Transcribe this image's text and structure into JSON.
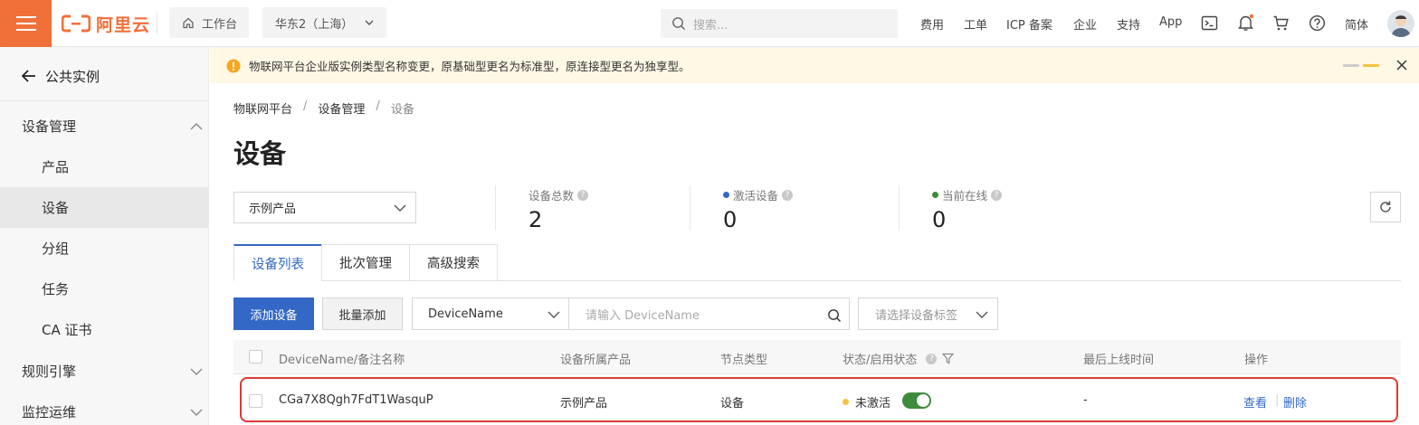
{
  "topbar": {
    "brand": "阿里云",
    "workbench": "工作台",
    "region": "华东2（上海）",
    "search_placeholder": "搜索...",
    "links": [
      "费用",
      "工单",
      "ICP 备案",
      "企业",
      "支持",
      "App"
    ],
    "lang": "简体"
  },
  "sidebar": {
    "back_label": "公共实例",
    "groups": [
      {
        "label": "设备管理",
        "expanded": true,
        "items": [
          "产品",
          "设备",
          "分组",
          "任务",
          "CA 证书"
        ]
      },
      {
        "label": "规则引擎",
        "expanded": false
      },
      {
        "label": "监控运维",
        "expanded": false
      }
    ],
    "active_item": "设备"
  },
  "banner": {
    "text": "物联网平台企业版实例类型名称变更，原基础型更名为标准型，原连接型更名为独享型。"
  },
  "breadcrumb": [
    "物联网平台",
    "设备管理",
    "设备"
  ],
  "page_title": "设备",
  "product_select": "示例产品",
  "stats": {
    "total": {
      "label": "设备总数",
      "value": "2"
    },
    "activated": {
      "label": "激活设备",
      "value": "0",
      "dot_color": "#3368c6"
    },
    "online": {
      "label": "当前在线",
      "value": "0",
      "dot_color": "#3f8a3d"
    }
  },
  "tabs": [
    "设备列表",
    "批次管理",
    "高级搜索"
  ],
  "toolbar": {
    "add": "添加设备",
    "batch_add": "批量添加",
    "field": "DeviceName",
    "search_placeholder": "请输入 DeviceName",
    "tag_placeholder": "请选择设备标签"
  },
  "table": {
    "headers": [
      "DeviceName/备注名称",
      "设备所属产品",
      "节点类型",
      "状态/启用状态",
      "最后上线时间",
      "操作"
    ],
    "rows": [
      {
        "name": "CGa7X8Qgh7FdT1WasquP",
        "product": "示例产品",
        "node_type": "设备",
        "status": "未激活",
        "status_dot": "#f5c242",
        "enabled": true,
        "last_online": "-",
        "actions": [
          "查看",
          "删除"
        ]
      }
    ]
  },
  "colors": {
    "brand": "#f1703a",
    "primary": "#3368c6",
    "highlight_border": "#d93c33"
  }
}
